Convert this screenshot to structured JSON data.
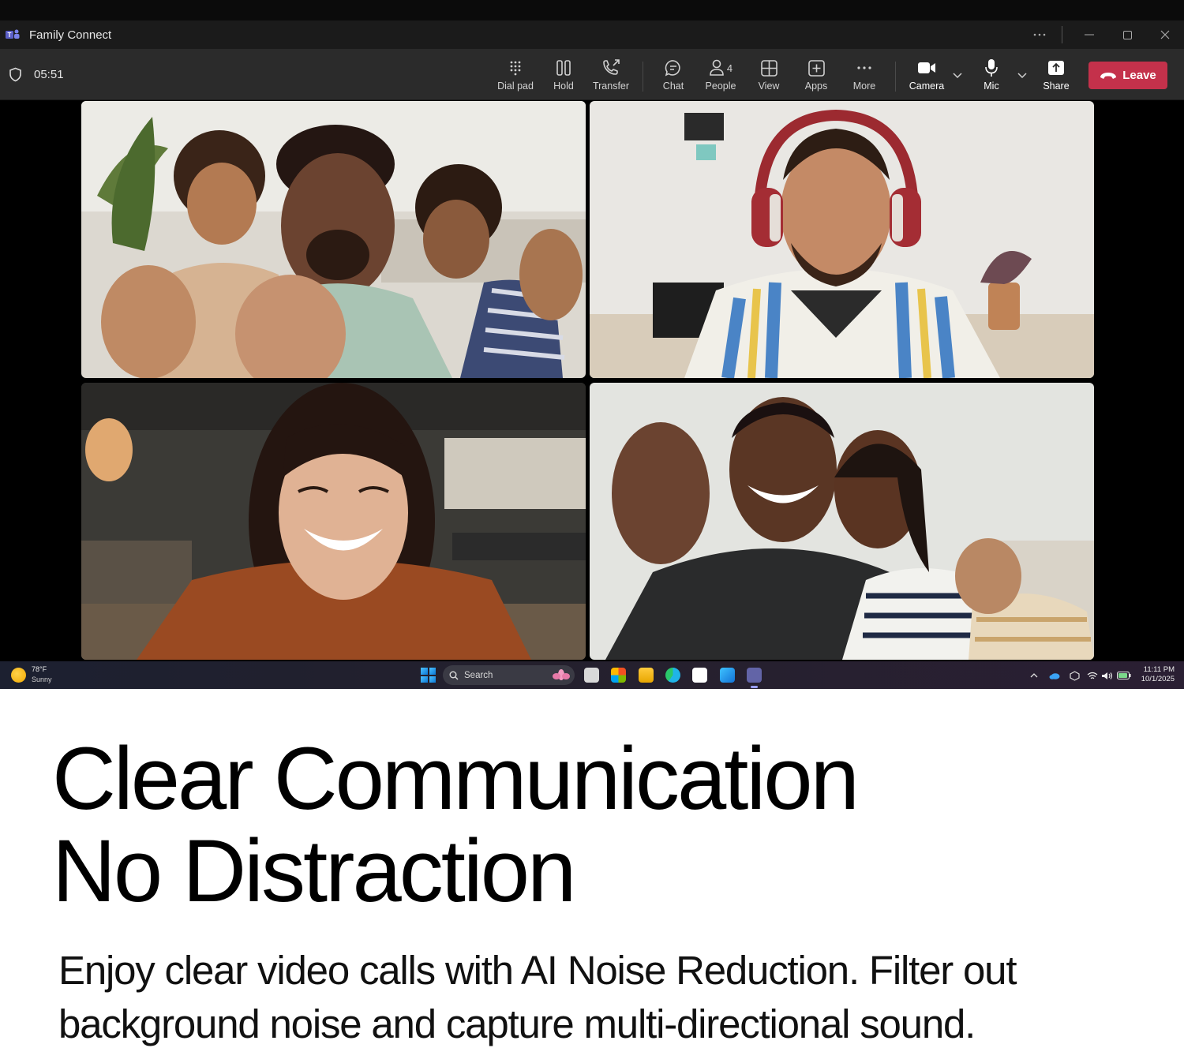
{
  "window": {
    "title": "Family Connect",
    "app_icon": "teams-icon",
    "controls": [
      "more-icon",
      "minimize-icon",
      "maximize-icon",
      "close-icon"
    ]
  },
  "call": {
    "timer": "05:51",
    "toolbar": {
      "dial_pad": "Dial pad",
      "hold": "Hold",
      "transfer": "Transfer",
      "chat": "Chat",
      "people": "People",
      "people_count": "4",
      "view": "View",
      "apps": "Apps",
      "more": "More",
      "camera": "Camera",
      "mic": "Mic",
      "share": "Share",
      "leave": "Leave"
    },
    "participants": [
      {
        "tile": "top-left",
        "description_icon": "family-video-feed"
      },
      {
        "tile": "top-right",
        "description_icon": "headphones-user-video-feed"
      },
      {
        "tile": "bottom-left",
        "description_icon": "smiling-woman-video-feed"
      },
      {
        "tile": "bottom-right",
        "description_icon": "family-with-baby-video-feed"
      }
    ]
  },
  "taskbar": {
    "weather_temp": "78°F",
    "weather_condition": "Sunny",
    "search_placeholder": "Search",
    "time": "11:11 PM",
    "date": "10/1/2025"
  },
  "marketing": {
    "headline_line1": "Clear Communication",
    "headline_line2": "No Distraction",
    "body_line1": "Enjoy clear video calls with AI Noise Reduction. Filter out",
    "body_line2": "background noise and capture multi-directional sound."
  },
  "colors": {
    "leave": "#c4314b",
    "toolbar": "#2b2b2b",
    "titlebar": "#1b1b1b",
    "stage": "#000000"
  }
}
